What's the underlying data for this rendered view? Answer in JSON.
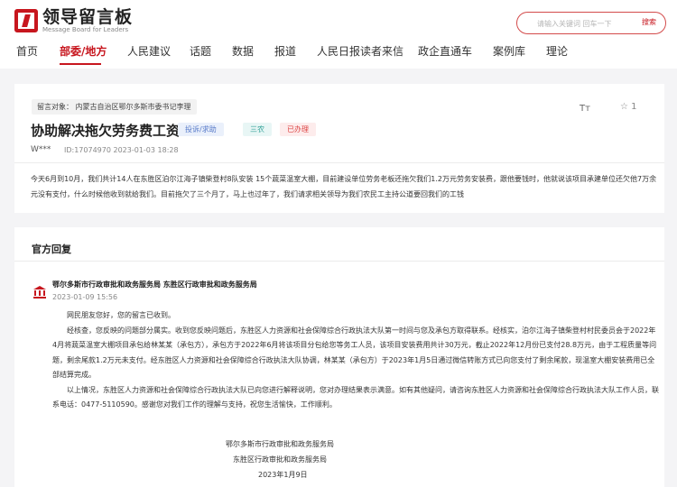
{
  "header": {
    "logo_cn": "领导留言板",
    "logo_en": "Message Board for Leaders",
    "search_placeholder": "请输入关键词 回车一下",
    "search_button": "搜索"
  },
  "nav": [
    {
      "label": "首页"
    },
    {
      "label": "部委/地方"
    },
    {
      "label": "人民建议"
    },
    {
      "label": "话题"
    },
    {
      "label": "数据"
    },
    {
      "label": "报道"
    },
    {
      "label": "人民日报读者来信"
    },
    {
      "label": "政企直通车"
    },
    {
      "label": "案例库"
    },
    {
      "label": "理论"
    }
  ],
  "message": {
    "target": "留言对象：  内蒙古自治区鄂尔多斯市委书记李理",
    "title": "协助解决拖欠劳务费工资",
    "tags": [
      "投诉/求助",
      "三农",
      "已办理"
    ],
    "font_toggle": "Tт",
    "star_count": "☆ 1",
    "user": "W***",
    "id_date": "ID:17074970   2023-01-03 18:28",
    "content": "今天6月到10月，我们共计14人在东胜区泊尔江海子镇柴登村8队安装 15个蔬菜温室大棚，目前建设单位劳务老板还拖欠我们1.2万元劳务安装费，跟他要钱时，他就说该项目承建单位还欠他7万余元没有支付，什么时候他收到就给我们。目前拖欠了三个月了，马上也过年了，我们请求相关领导为我们农民工主持公道要回我们的工钱"
  },
  "reply": {
    "section_title": "官方回复",
    "org": "鄂尔多斯市行政审批和政务服务局 东胜区行政审批和政务服务局",
    "date": "2023-01-09 15:56",
    "paragraphs": [
      "网民朋友您好，您的留言已收到。",
      "经核查，您反映的问题部分属实。收到您反映问题后，东胜区人力资源和社会保障综合行政执法大队第一时间与您及承包方取得联系。经核实，泊尔江海子镇柴登村村民委员会于2022年4月将蔬菜温室大棚项目承包给林某某（承包方），承包方于2022年6月将该项目分包给您等务工人员，该项目安装费用共计30万元，截止2022年12月份已支付28.8万元，由于工程质量等问题，剩余尾款1.2万元未支付。经东胜区人力资源和社会保障综合行政执法大队协调，林某某（承包方）于2023年1月5日通过微信转账方式已向您支付了剩余尾款，现温室大棚安装费用已全部结算完成。",
      "以上情况，东胜区人力资源和社会保障综合行政执法大队已向您进行解释说明，您对办理结果表示满意。如有其他疑问，请咨询东胜区人力资源和社会保障综合行政执法大队工作人员，联系电话：0477-5110590。感谢您对我们工作的理解与支持，祝您生活愉快，工作顺利。"
    ],
    "sign_org1": "鄂尔多斯市行政审批和政务服务局",
    "sign_org2": "东胜区行政审批和政务服务局",
    "sign_date": "2023年1月9日"
  },
  "colors": {
    "brand_red": "#c7161e",
    "tag_blue": "#5679c8",
    "tag_teal": "#36a39a",
    "tag_red": "#dd4444"
  },
  "icons": [
    "logo-icon",
    "bank-building-icon",
    "star-icon",
    "font-size-icon"
  ]
}
